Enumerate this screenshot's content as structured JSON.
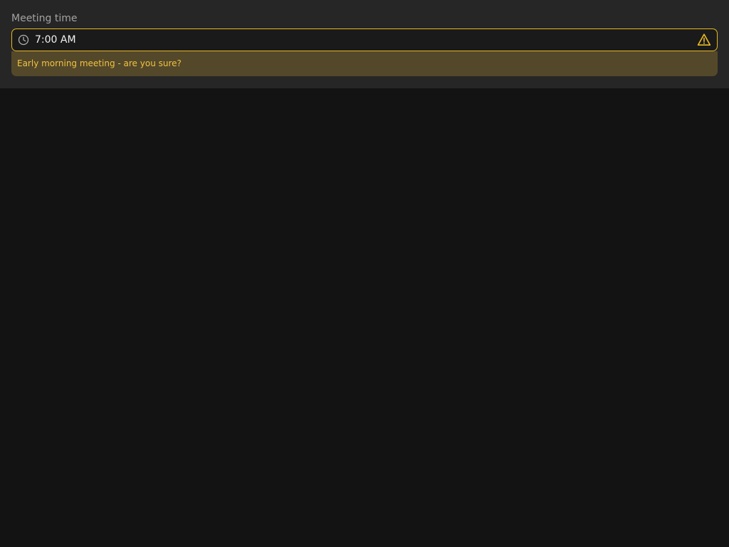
{
  "field": {
    "label": "Meeting time",
    "value": "7:00 AM",
    "icon": "clock-icon",
    "status_icon": "warning-icon"
  },
  "warning": {
    "message": "Early morning meeting - are you sure?"
  },
  "colors": {
    "background": "#131313",
    "panel": "#262626",
    "accent_warning": "#e8b923",
    "warning_bg": "#54482a",
    "warning_text": "#f0c340",
    "label_text": "#a3a3a3",
    "value_text": "#f2f2f2"
  }
}
